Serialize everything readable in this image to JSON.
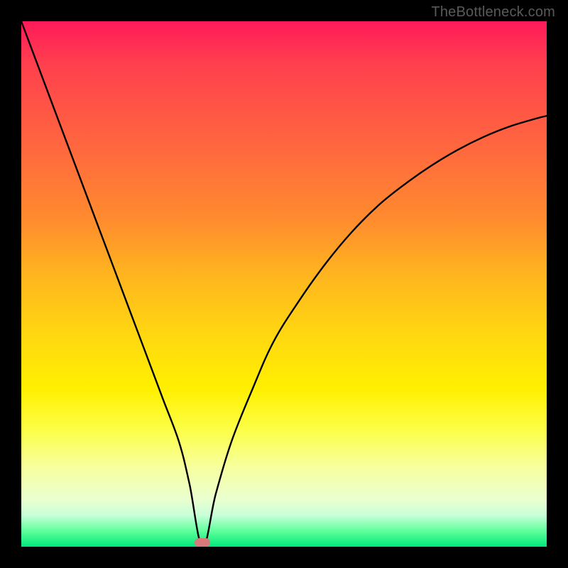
{
  "watermark": "TheBottleneck.com",
  "chart_data": {
    "type": "line",
    "title": "",
    "xlabel": "",
    "ylabel": "",
    "xlim": [
      0,
      100
    ],
    "ylim": [
      0,
      100
    ],
    "grid": false,
    "note": "V-shaped bottleneck curve over a red→green vertical gradient; minimum marked by a small pink pill near the bottom.",
    "series": [
      {
        "name": "bottleneck-curve",
        "x": [
          0,
          3,
          6,
          9,
          12,
          15,
          18,
          21,
          24,
          27,
          30,
          32,
          34.5,
          37,
          40,
          44,
          48,
          53,
          58,
          63,
          68,
          73,
          78,
          83,
          88,
          93,
          98,
          100
        ],
        "y": [
          100,
          92,
          84,
          76,
          68,
          60,
          52,
          44,
          36,
          28,
          20,
          12,
          0,
          10,
          20,
          30,
          39,
          47,
          54,
          60,
          65,
          69,
          72.5,
          75.5,
          78,
          80,
          81.5,
          82
        ]
      }
    ],
    "minimum_marker": {
      "x": 34.5,
      "y": 0
    }
  }
}
